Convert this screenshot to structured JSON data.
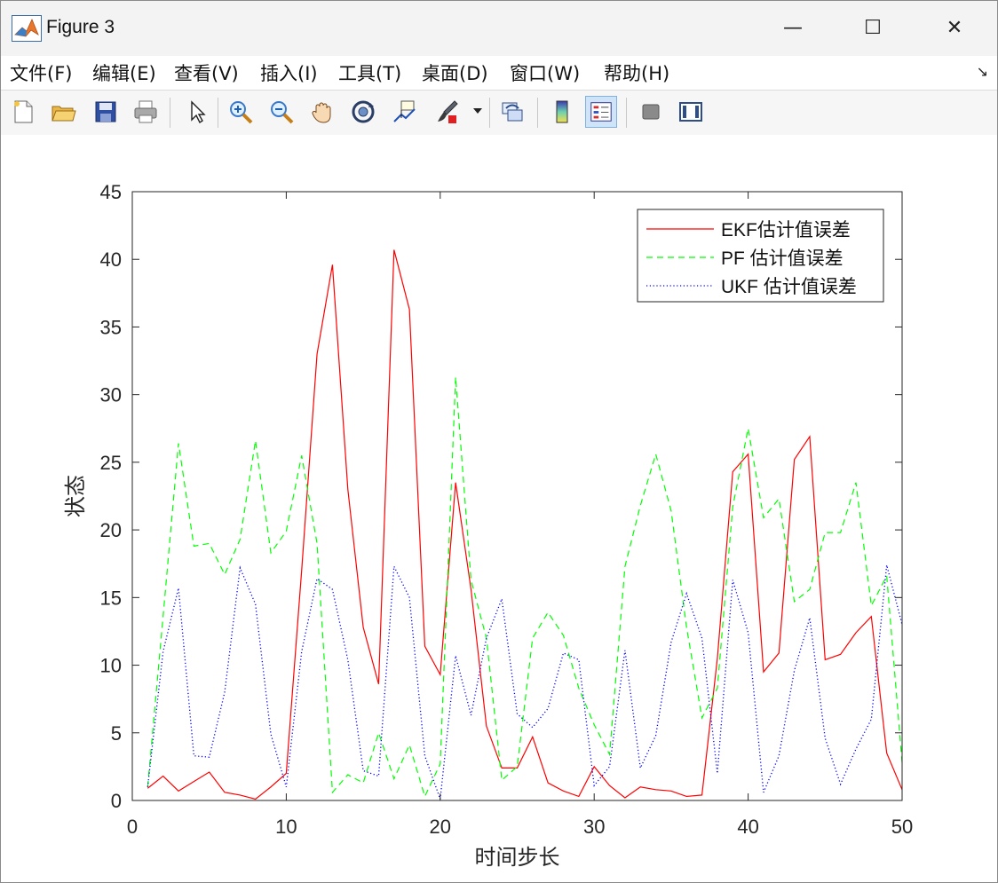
{
  "window": {
    "title": "Figure 3",
    "buttons": {
      "minimize": "—",
      "maximize": "☐",
      "close": "✕"
    }
  },
  "menu": [
    "文件(F)",
    "编辑(E)",
    "查看(V)",
    "插入(I)",
    "工具(T)",
    "桌面(D)",
    "窗口(W)",
    "帮助(H)"
  ],
  "toolbar_icons": [
    "new-figure-icon",
    "open-file-icon",
    "save-icon",
    "print-icon",
    "pointer-icon",
    "zoom-in-icon",
    "zoom-out-icon",
    "pan-hand-icon",
    "rotate-3d-icon",
    "data-cursor-icon",
    "brush-icon",
    "link-plot-icon",
    "colorbar-icon",
    "legend-icon",
    "hide-plot-tools-icon",
    "show-plot-tools-icon"
  ],
  "chart_data": {
    "type": "line",
    "xlabel": "时间步长",
    "ylabel": "状态",
    "xlim": [
      0,
      50
    ],
    "ylim": [
      0,
      45
    ],
    "xticks": [
      0,
      10,
      20,
      30,
      40,
      50
    ],
    "yticks": [
      0,
      5,
      10,
      15,
      20,
      25,
      30,
      35,
      40,
      45
    ],
    "grid": false,
    "legend_position": "top-right",
    "x": [
      1,
      2,
      3,
      4,
      5,
      6,
      7,
      8,
      9,
      10,
      11,
      12,
      13,
      14,
      15,
      16,
      17,
      18,
      19,
      20,
      21,
      22,
      23,
      24,
      25,
      26,
      27,
      28,
      29,
      30,
      31,
      32,
      33,
      34,
      35,
      36,
      37,
      38,
      39,
      40,
      41,
      42,
      43,
      44,
      45,
      46,
      47,
      48,
      49,
      50
    ],
    "series": [
      {
        "name": "EKF估计值误差",
        "color": "#ff0000",
        "style": "solid",
        "values": [
          0.9,
          1.8,
          0.7,
          1.4,
          2.1,
          0.6,
          0.4,
          0.1,
          1.0,
          2.0,
          17.0,
          33.0,
          39.6,
          23.0,
          12.8,
          8.6,
          40.7,
          36.3,
          11.4,
          9.3,
          23.5,
          15.6,
          5.5,
          2.4,
          2.4,
          4.7,
          1.3,
          0.7,
          0.3,
          2.5,
          1.1,
          0.2,
          1.0,
          0.8,
          0.7,
          0.3,
          0.4,
          10.5,
          24.3,
          25.6,
          9.5,
          10.9,
          25.2,
          26.9,
          10.4,
          10.8,
          12.4,
          13.6,
          3.5,
          0.8
        ]
      },
      {
        "name": "PF 估计值误差",
        "color": "#00ff00",
        "style": "dashed",
        "values": [
          1.0,
          13.6,
          26.4,
          18.8,
          19.0,
          16.7,
          19.3,
          26.6,
          18.3,
          19.9,
          25.5,
          19.0,
          0.6,
          1.9,
          1.3,
          5.0,
          1.6,
          4.1,
          0.3,
          2.7,
          31.3,
          16.3,
          12.0,
          1.5,
          2.5,
          12.0,
          13.9,
          12.2,
          8.3,
          5.6,
          3.4,
          17.3,
          21.8,
          25.6,
          21.4,
          12.8,
          6.1,
          8.3,
          21.7,
          27.5,
          20.9,
          22.3,
          14.7,
          15.6,
          19.8,
          19.8,
          23.5,
          14.4,
          16.6,
          2.8
        ]
      },
      {
        "name": "UKF 估计值误差",
        "color": "#0000ff",
        "style": "dotted",
        "values": [
          1.0,
          11.0,
          15.7,
          3.3,
          3.2,
          8.0,
          17.2,
          14.5,
          4.9,
          1.0,
          11.0,
          16.4,
          15.6,
          10.4,
          2.2,
          1.8,
          17.3,
          15.0,
          3.3,
          0.1,
          10.7,
          6.3,
          12.0,
          14.9,
          6.4,
          5.4,
          6.8,
          10.9,
          10.4,
          1.1,
          2.5,
          11.1,
          2.4,
          4.8,
          11.7,
          15.3,
          12.0,
          2.0,
          16.3,
          12.4,
          0.6,
          3.3,
          9.6,
          13.5,
          4.6,
          1.2,
          3.8,
          6.0,
          17.4,
          13.0
        ]
      }
    ]
  }
}
